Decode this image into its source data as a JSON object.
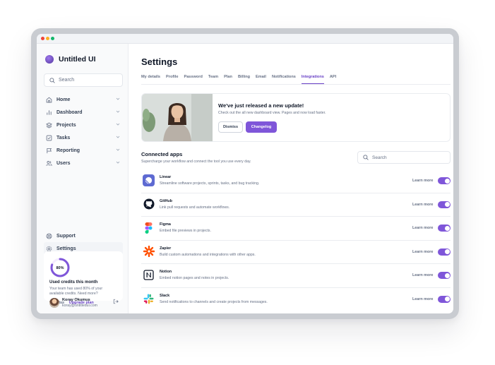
{
  "app": {
    "name": "Untitled UI"
  },
  "sidebar": {
    "search_placeholder": "Search",
    "items": [
      {
        "label": "Home",
        "icon": "home-icon"
      },
      {
        "label": "Dashboard",
        "icon": "bar-chart-icon"
      },
      {
        "label": "Projects",
        "icon": "layers-icon"
      },
      {
        "label": "Tasks",
        "icon": "check-square-icon"
      },
      {
        "label": "Reporting",
        "icon": "flag-icon"
      },
      {
        "label": "Users",
        "icon": "users-icon"
      }
    ],
    "bottom_items": [
      {
        "label": "Support",
        "icon": "life-buoy-icon"
      },
      {
        "label": "Settings",
        "icon": "gear-icon"
      }
    ],
    "credits": {
      "percent_label": "80%",
      "percent": 80,
      "title": "Used credits this month",
      "description": "Your team has used 80% of your available credits. Need more?",
      "dismiss": "Dismiss",
      "upgrade": "Upgrade plan"
    },
    "user": {
      "name": "Koray Okumus",
      "email": "koray@untitledui.com"
    }
  },
  "main": {
    "title": "Settings",
    "tabs": [
      "My details",
      "Profile",
      "Password",
      "Team",
      "Plan",
      "Billing",
      "Email",
      "Notifications",
      "Integrations",
      "API"
    ],
    "active_tab": "Integrations",
    "banner": {
      "title": "We've just released a new update!",
      "description": "Check out the all new dashboard view. Pages and now load faster.",
      "dismiss": "Dismiss",
      "changelog": "Changelog"
    },
    "connected": {
      "title": "Connected apps",
      "description": "Supercharge your workflow and connect the tool you use every day.",
      "search_placeholder": "Search",
      "learn_more": "Learn more",
      "apps": [
        {
          "name": "Linear",
          "description": "Streamline software projects, sprints, tasks, and bug tracking.",
          "enabled": true
        },
        {
          "name": "GitHub",
          "description": "Link pull requests and automate workflows.",
          "enabled": true
        },
        {
          "name": "Figma",
          "description": "Embed file previews in projects.",
          "enabled": true
        },
        {
          "name": "Zapier",
          "description": "Build custom automations and integrations with other apps.",
          "enabled": true
        },
        {
          "name": "Notion",
          "description": "Embed notion pages and notes in projects.",
          "enabled": true
        },
        {
          "name": "Slack",
          "description": "Send notifications to channels and create projects from messages.",
          "enabled": true
        }
      ]
    }
  },
  "colors": {
    "accent": "#7f56d9",
    "accent_text": "#6941c6"
  }
}
